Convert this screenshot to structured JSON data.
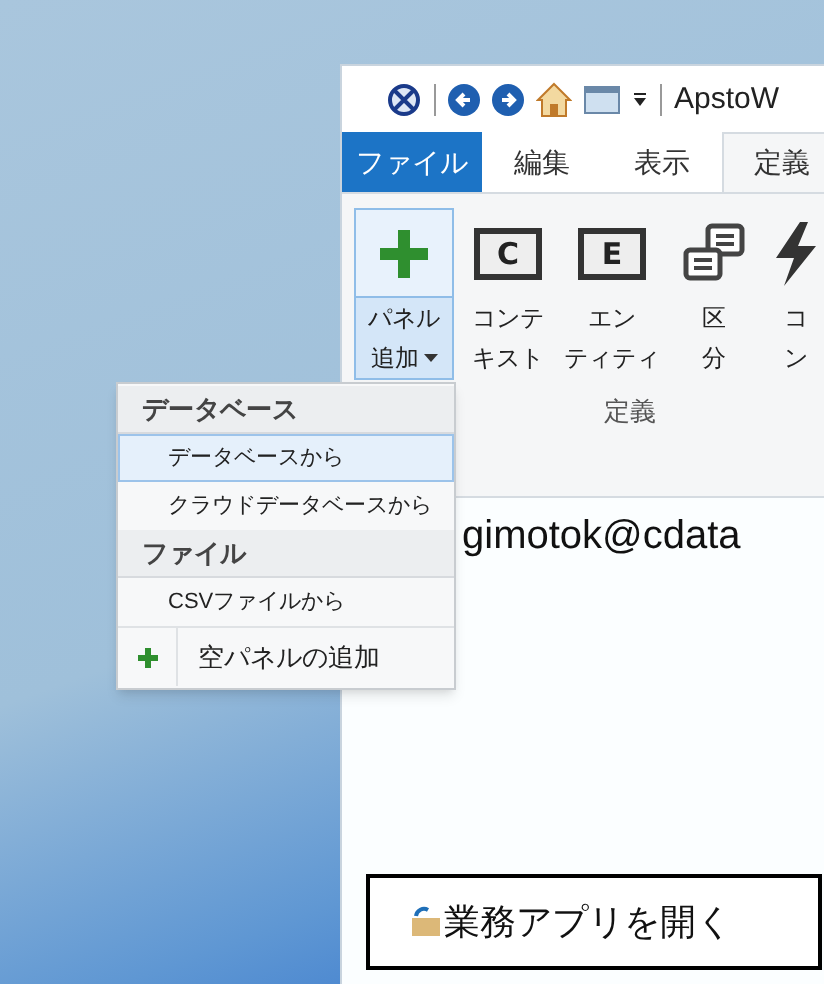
{
  "window": {
    "title": "ApstoW"
  },
  "tabs": [
    {
      "label": "ファイル",
      "kind": "file",
      "selected": false
    },
    {
      "label": "編集",
      "kind": "tab",
      "selected": false
    },
    {
      "label": "表示",
      "kind": "tab",
      "selected": false
    },
    {
      "label": "定義",
      "kind": "tab",
      "selected": true
    }
  ],
  "ribbon": {
    "buttons": [
      {
        "lines": [
          "パネル",
          "追加"
        ],
        "kind": "plus",
        "dropdown": true,
        "selected": true
      },
      {
        "lines": [
          "コンテ",
          "キスト"
        ],
        "kind": "letter",
        "letter": "C",
        "dropdown": false,
        "selected": false
      },
      {
        "lines": [
          "エン",
          "ティティ"
        ],
        "kind": "letter",
        "letter": "E",
        "dropdown": false,
        "selected": false
      },
      {
        "lines": [
          "区",
          "分"
        ],
        "kind": "panels",
        "dropdown": false,
        "selected": false
      },
      {
        "lines": [
          "コ",
          "ン"
        ],
        "kind": "bolt",
        "dropdown": false,
        "selected": false
      }
    ],
    "group_label": "定義"
  },
  "content": {
    "user_text": "gimotok@cdata",
    "open_button": "業務アプリを開く"
  },
  "menu": [
    {
      "kind": "header",
      "label": "データベース"
    },
    {
      "kind": "item",
      "label": "データベースから",
      "selected": true
    },
    {
      "kind": "item",
      "label": "クラウドデータベースから",
      "selected": false
    },
    {
      "kind": "header",
      "label": "ファイル"
    },
    {
      "kind": "item",
      "label": "CSVファイルから",
      "selected": false
    },
    {
      "kind": "plus",
      "label": "空パネルの追加",
      "selected": false
    }
  ]
}
